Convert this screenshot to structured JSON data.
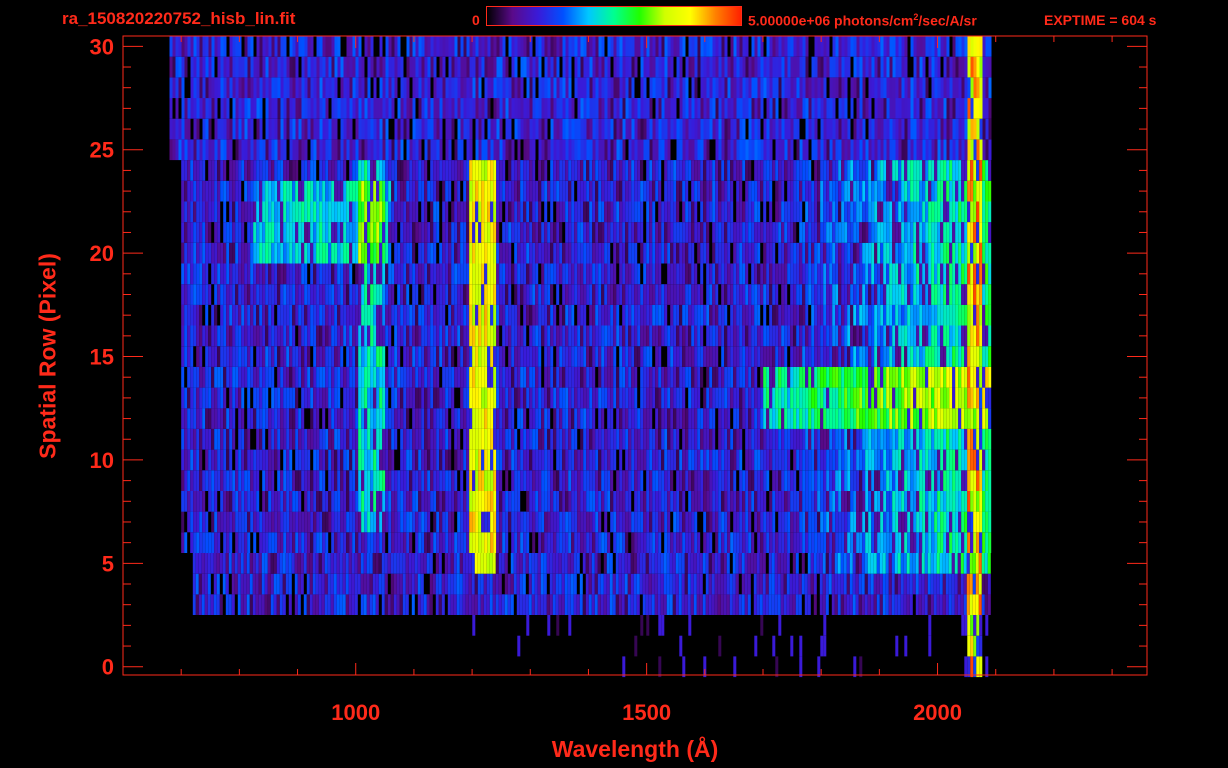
{
  "header": {
    "title": "ra_150820220752_hisb_lin.fit",
    "colorbar_min": "0",
    "colorbar_max_value": "5.00000e+06 photons/cm",
    "colorbar_max_sup": "2",
    "colorbar_max_unit": "/sec/A/sr",
    "exptime": "EXPTIME = 604 s"
  },
  "colors": {
    "axis": "#ff2a1a",
    "background": "#000000",
    "colormap": [
      "#000000",
      "#5a0a8a",
      "#3a1ad8",
      "#0050ff",
      "#00c8ff",
      "#00ff90",
      "#20ff00",
      "#d0ff00",
      "#ffff00",
      "#ff8000",
      "#ff2000"
    ]
  },
  "chart_data": {
    "type": "heatmap",
    "title": "",
    "xlabel": "Wavelength (Å)",
    "ylabel": "Spatial Row (Pixel)",
    "xlim": [
      600,
      2360
    ],
    "ylim": [
      -0.4,
      30.5
    ],
    "xticks": [
      1000,
      1500,
      2000
    ],
    "xtick_labels": [
      "1000",
      "1500",
      "2000"
    ],
    "yticks": [
      0,
      5,
      10,
      15,
      20,
      25,
      30
    ],
    "ytick_labels": [
      "0",
      "5",
      "10",
      "15",
      "20",
      "25",
      "30"
    ],
    "colorbar_range": [
      0,
      5000000
    ],
    "data_extent": {
      "wavelength": [
        680,
        2090
      ],
      "rows": [
        0,
        30
      ]
    },
    "features": [
      {
        "wavelength": 1216,
        "rows": [
          5,
          24
        ],
        "level": "high"
      },
      {
        "wavelength": 2060,
        "rows": [
          0,
          30
        ],
        "level": "high"
      },
      {
        "wavelength_range": [
          1700,
          2060
        ],
        "rows": [
          12,
          14
        ],
        "level": "medium-high"
      },
      {
        "wavelength_range": [
          820,
          1060
        ],
        "rows": [
          20,
          23
        ],
        "level": "medium"
      },
      {
        "wavelength_range": [
          1800,
          2060
        ],
        "rows": [
          6,
          24
        ],
        "level": "medium"
      }
    ]
  }
}
